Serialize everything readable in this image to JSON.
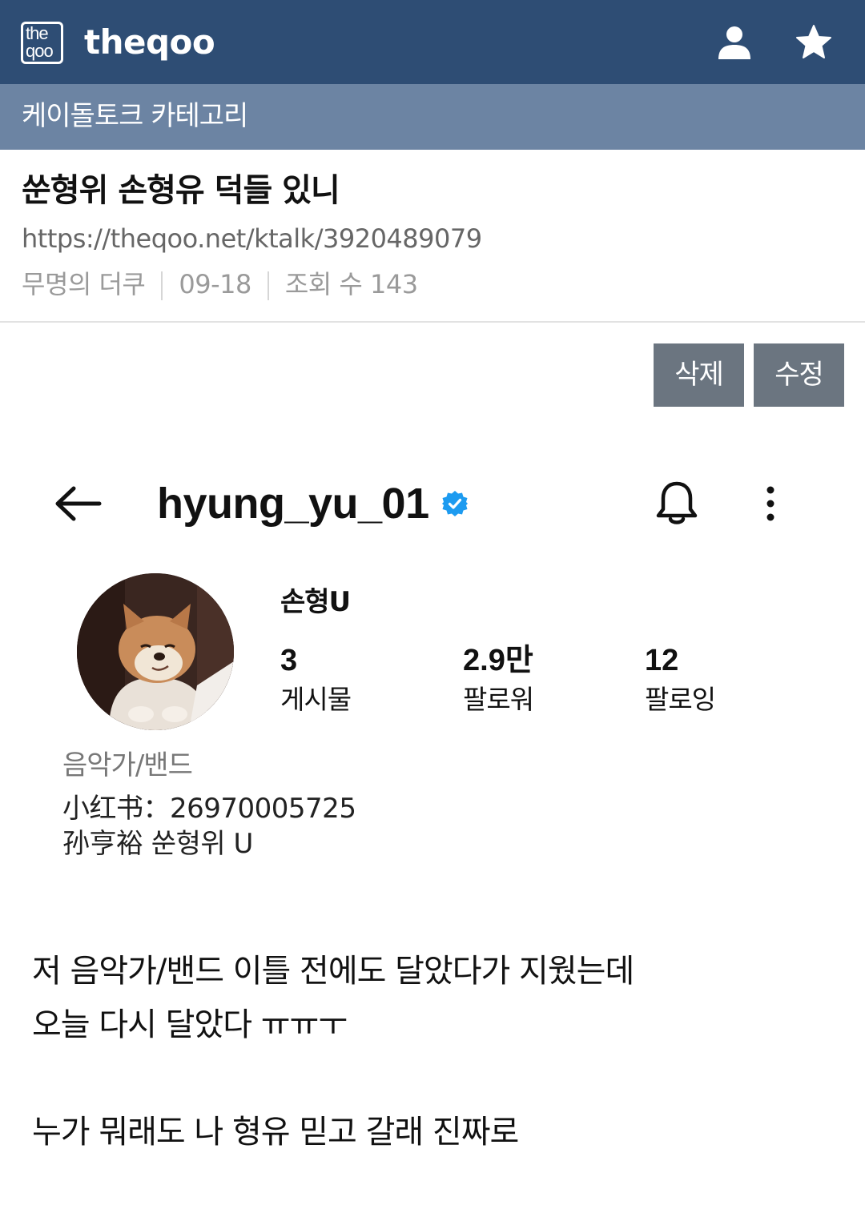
{
  "header": {
    "logo_line1": "the",
    "logo_line2": "qoo",
    "brand": "theqoo",
    "icons": [
      "user-icon",
      "star-icon"
    ]
  },
  "category": {
    "label": "케이돌토크 카테고리"
  },
  "post": {
    "title": "쑨형위 손형유 덕들 있니",
    "url": "https://theqoo.net/ktalk/3920489079",
    "author": "무명의 더쿠",
    "date": "09-18",
    "views": "조회 수 143"
  },
  "actions": {
    "delete_label": "삭제",
    "edit_label": "수정"
  },
  "profile": {
    "username": "hyung_yu_01",
    "display_name": "손형U",
    "stats": [
      {
        "value": "3",
        "label": "게시물"
      },
      {
        "value": "2.9만",
        "label": "팔로워"
      },
      {
        "value": "12",
        "label": "팔로잉"
      }
    ],
    "category": "음악가/밴드",
    "bio_line1": "小红书：26970005725",
    "bio_line2": "孙亨裕 쑨형위 U",
    "icons": [
      "back-arrow-icon",
      "verified-badge-icon",
      "bell-icon",
      "more-vertical-icon"
    ]
  },
  "content": {
    "line1": "저 음악가/밴드 이틀 전에도 달았다가 지웠는데",
    "line2": "오늘 다시 달았다 ㅠㅠㅜ",
    "line3": "누가 뭐래도 나 형유 믿고 갈래 진짜로"
  },
  "colors": {
    "header_bg": "#2e4d74",
    "category_bg": "#6c84a3",
    "button_bg": "#6b7580",
    "verified_blue": "#1d9bf0"
  }
}
